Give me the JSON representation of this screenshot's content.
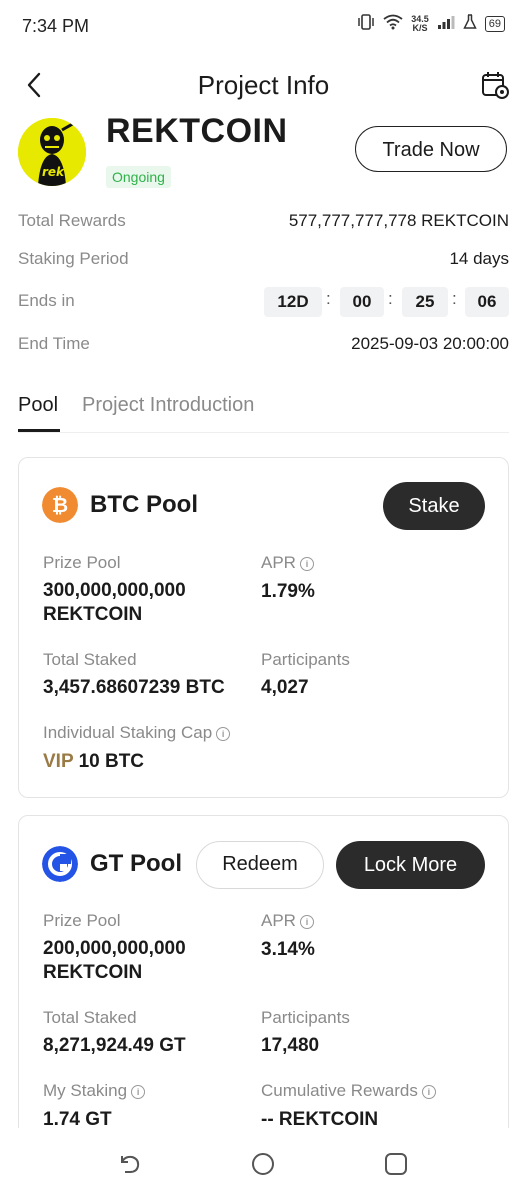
{
  "status_bar": {
    "time": "7:34 PM",
    "speed_value": "34.5",
    "speed_unit": "K/S",
    "battery": "69"
  },
  "header": {
    "title": "Project Info",
    "back_icon": "chevron-left-icon",
    "settings_icon": "calendar-gear-icon"
  },
  "project": {
    "name": "REKTCOIN",
    "status": "Ongoing",
    "trade_label": "Trade Now",
    "logo_text": "rekt",
    "logo_color": "#e7e900"
  },
  "details": {
    "total_rewards_label": "Total Rewards",
    "total_rewards_value": "577,777,777,778 REKTCOIN",
    "staking_period_label": "Staking Period",
    "staking_period_value": "14 days",
    "ends_in_label": "Ends in",
    "ends_in": {
      "days": "12D",
      "hours": "00",
      "minutes": "25",
      "seconds": "06",
      "sep": ":"
    },
    "end_time_label": "End Time",
    "end_time_value": "2025-09-03 20:00:00"
  },
  "tabs": [
    {
      "label": "Pool",
      "active": true
    },
    {
      "label": "Project Introduction",
      "active": false
    }
  ],
  "btc_pool": {
    "title": "BTC Pool",
    "icon": "bitcoin-icon",
    "icon_color": "#f08b31",
    "stake_label": "Stake",
    "prize_pool_label": "Prize Pool",
    "prize_pool_amount": "300,000,000,000",
    "prize_pool_unit": "REKTCOIN",
    "apr_label": "APR",
    "apr_value": "1.79%",
    "total_staked_label": "Total Staked",
    "total_staked_value": "3,457.68607239 BTC",
    "participants_label": "Participants",
    "participants_value": "4,027",
    "cap_label": "Individual Staking Cap",
    "cap_vip": "VIP",
    "cap_value": "10 BTC"
  },
  "gt_pool": {
    "title": "GT Pool",
    "icon": "gatetoken-icon",
    "icon_color": "#2354e6",
    "redeem_label": "Redeem",
    "lock_more_label": "Lock More",
    "prize_pool_label": "Prize Pool",
    "prize_pool_amount": "200,000,000,000",
    "prize_pool_unit": "REKTCOIN",
    "apr_label": "APR",
    "apr_value": "3.14%",
    "total_staked_label": "Total Staked",
    "total_staked_value": "8,271,924.49 GT",
    "participants_label": "Participants",
    "participants_value": "17,480",
    "my_staking_label": "My Staking",
    "my_staking_value": "1.74 GT",
    "cumulative_label": "Cumulative Rewards",
    "cumulative_value": "-- REKTCOIN"
  },
  "colors": {
    "accent_dark": "#2b2b2b",
    "status_green": "#2fb24a",
    "vip_gold": "#9a7a45"
  }
}
